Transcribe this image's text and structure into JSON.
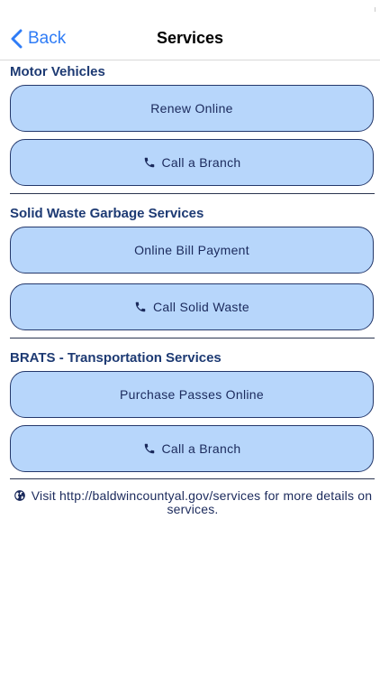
{
  "nav": {
    "back_label": "Back",
    "title": "Services"
  },
  "sections": [
    {
      "title": "Motor Vehicles",
      "buttons": [
        {
          "label": "Renew Online",
          "icon": null
        },
        {
          "label": "Call a Branch",
          "icon": "phone-icon"
        }
      ]
    },
    {
      "title": "Solid Waste Garbage Services",
      "buttons": [
        {
          "label": "Online Bill Payment",
          "icon": null
        },
        {
          "label": "Call Solid Waste",
          "icon": "phone-icon"
        }
      ]
    },
    {
      "title": "BRATS - Transportation Services",
      "buttons": [
        {
          "label": "Purchase Passes Online",
          "icon": null
        },
        {
          "label": "Call a Branch",
          "icon": "phone-icon"
        }
      ]
    }
  ],
  "footer": {
    "icon": "globe-icon",
    "text": "Visit http://baldwincountyal.gov/services for more details on services."
  },
  "colors": {
    "button_fill": "#b7d6fb",
    "button_border": "#24386b",
    "section_title": "#1d3a73",
    "back_link": "#2f7cf6"
  }
}
